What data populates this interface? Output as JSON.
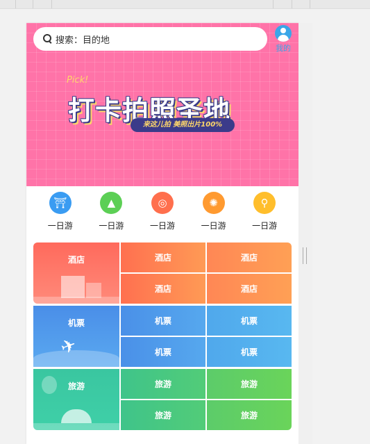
{
  "search": {
    "placeholder": "搜索：目的地"
  },
  "user": {
    "label": "我的"
  },
  "banner": {
    "title": "打卡拍照圣地",
    "subtitle": "来这儿拍 美照出片100%",
    "deco_text": "Pick!"
  },
  "icons": [
    {
      "label": "一日游",
      "icon": "temple-icon",
      "color": "#3a9cf2"
    },
    {
      "label": "一日游",
      "icon": "mountain-icon",
      "color": "#5ccf55"
    },
    {
      "label": "一日游",
      "icon": "dragon-icon",
      "color": "#ff6f4d"
    },
    {
      "label": "一日游",
      "icon": "wheel-icon",
      "color": "#ff9a30"
    },
    {
      "label": "一日游",
      "icon": "location-person-icon",
      "color": "#ffbe2c"
    }
  ],
  "grid": {
    "hotel": {
      "title": "酒店",
      "cells": [
        "酒店",
        "酒店",
        "酒店",
        "酒店"
      ]
    },
    "flight": {
      "title": "机票",
      "cells": [
        "机票",
        "机票",
        "机票",
        "机票"
      ]
    },
    "travel": {
      "title": "旅游",
      "cells": [
        "旅游",
        "旅游",
        "旅游",
        "旅游"
      ]
    }
  }
}
